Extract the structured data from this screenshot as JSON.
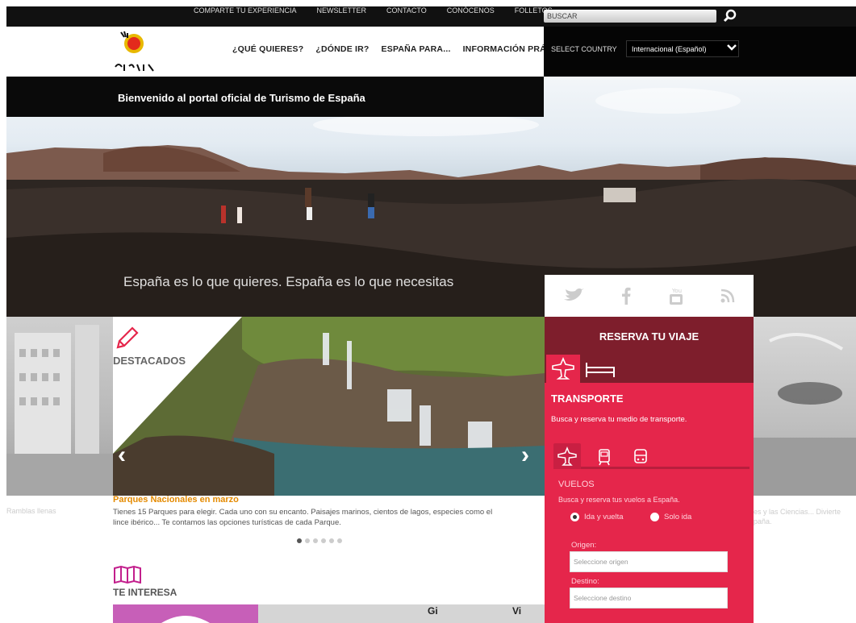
{
  "topbar": {
    "links": [
      "COMPARTE TU EXPERIENCIA",
      "NEWSLETTER",
      "CONTACTO",
      "CONÓCENOS",
      "FOLLETOS"
    ],
    "search_placeholder": "BUSCAR"
  },
  "header": {
    "logo_text": "España",
    "nav": [
      "¿QUÉ QUIERES?",
      "¿DÓNDE IR?",
      "ESPAÑA PARA...",
      "INFORMACIÓN PRÁCTICA"
    ],
    "select_country_label": "SELECT COUNTRY",
    "country_value": "Internacional (Español)"
  },
  "welcome": "Bienvenido al portal oficial de Turismo de España",
  "hero": {
    "tagline": "España es lo que quieres. España es lo que necesitas"
  },
  "social": [
    "twitter-icon",
    "facebook-icon",
    "youtube-icon",
    "rss-icon"
  ],
  "destacados": {
    "label": "DESTACADOS",
    "left_caption": "Ramblas llenas",
    "right_caption_1": "es y las Ciencias... Divierte",
    "right_caption_2": "paña.",
    "title": "Parques Nacionales en marzo",
    "text": "Tienes 15 Parques para elegir. Cada uno con su encanto. Paisajes marinos, cientos de lagos, especies como el lince ibérico... Te contamos las opciones turísticas de cada Parque.",
    "dots": 6,
    "active_dot": 0
  },
  "te_interesa": {
    "label": "TE INTERESA",
    "tile_text_1": "Gi",
    "tile_text_2": "Vi"
  },
  "reserva": {
    "title": "RESERVA TU VIAJE",
    "section": "TRANSPORTE",
    "desc": "Busca y reserva tu medio de transporte.",
    "vuelos_title": "VUELOS",
    "vuelos_desc": "Busca y reserva tus vuelos a España.",
    "radio_1": "Ida y vuelta",
    "radio_2": "Solo ida",
    "origen_label": "Origen:",
    "origen_placeholder": "Seleccione origen",
    "destino_label": "Destino:",
    "destino_placeholder": "Seleccione destino"
  },
  "colors": {
    "reserva_dark": "#7e1e2c",
    "reserva_red": "#e5264b",
    "accent_orange": "#e48a00",
    "destacados_icon": "#e5264b",
    "interesa_icon": "#c21f8c"
  }
}
